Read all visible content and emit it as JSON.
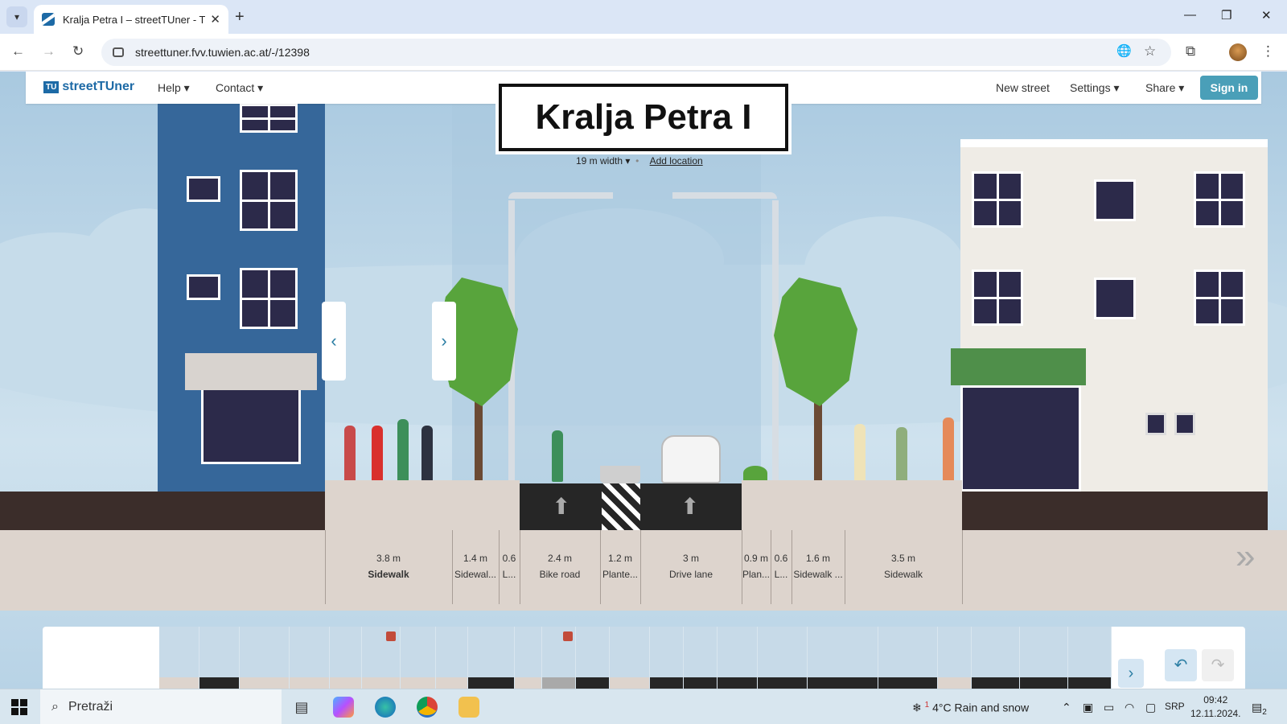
{
  "browser": {
    "tab_title": "Kralja Petra I – streetTUner - TU",
    "url": "streettuner.fvv.tuwien.ac.at/-/12398"
  },
  "app": {
    "logo_badge": "TU",
    "logo_text": "streetTUner",
    "menu_help": "Help",
    "menu_contact": "Contact",
    "new_street": "New street",
    "settings": "Settings",
    "share": "Share",
    "sign_in": "Sign in"
  },
  "street": {
    "name": "Kralja Petra I",
    "width": "19 m width",
    "add_location": "Add location"
  },
  "segments": [
    {
      "width": "3.8 m",
      "name": "Sidewalk"
    },
    {
      "width": "1.4 m",
      "name": "Sidewal..."
    },
    {
      "width": "0.6",
      "name": "L..."
    },
    {
      "width": "2.4 m",
      "name": "Bike road"
    },
    {
      "width": "1.2 m",
      "name": "Plante..."
    },
    {
      "width": "3 m",
      "name": "Drive lane"
    },
    {
      "width": "0.9 m",
      "name": "Plan..."
    },
    {
      "width": "0.6",
      "name": "L..."
    },
    {
      "width": "1.6 m",
      "name": "Sidewalk ..."
    },
    {
      "width": "3.5 m",
      "name": "Sidewalk"
    }
  ],
  "icons": {
    "undo": "undo-icon",
    "redo": "redo-icon",
    "palette_next": "chevron-right-icon"
  },
  "taskbar": {
    "search_placeholder": "Pretraži",
    "weather": "4°C  Rain and snow",
    "lang": "SRP",
    "time": "09:42",
    "date": "12.11.2024.",
    "notif_count": "2",
    "weather_alert": "1"
  },
  "colors": {
    "brand": "#1d6aa6",
    "signin": "#4a9fb8",
    "building_left": "#36679a",
    "awning_right": "#4f8f4a"
  }
}
